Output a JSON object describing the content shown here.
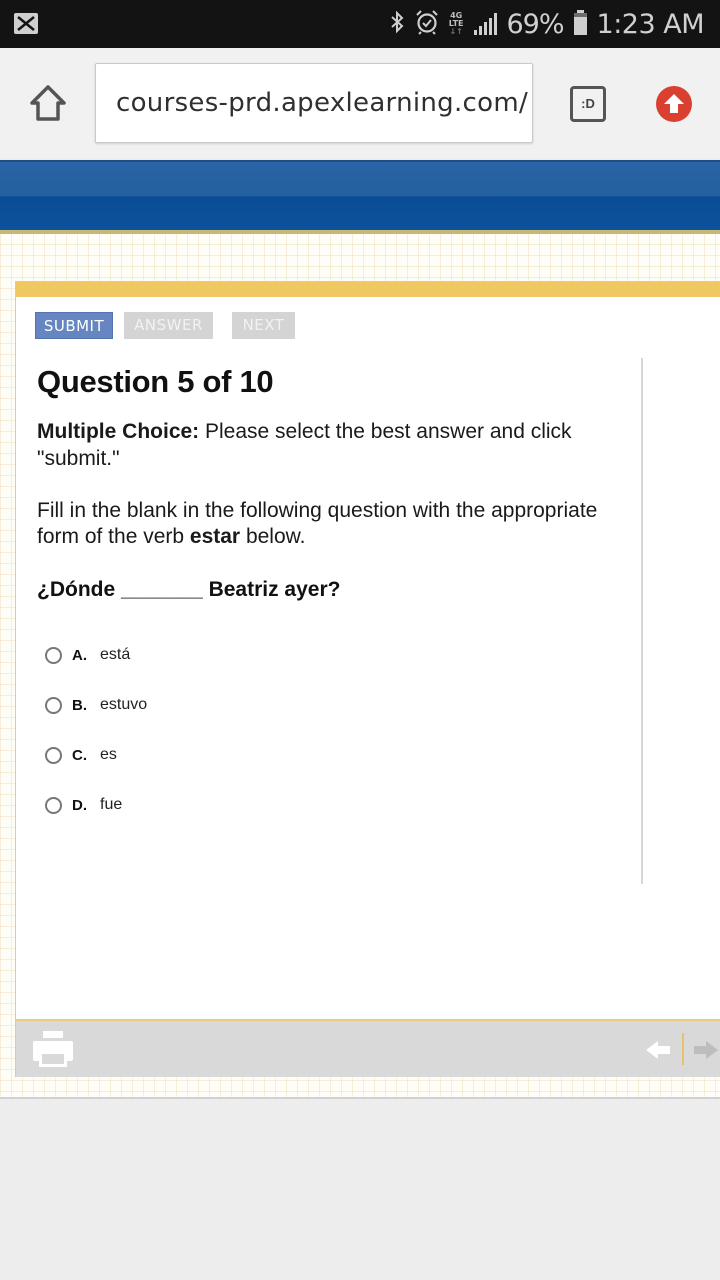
{
  "status_bar": {
    "notification_icon": "mail-x-icon",
    "icons": [
      "bluetooth-icon",
      "alarm-icon",
      "4g-lte-icon",
      "signal-icon"
    ],
    "network_label_top": "4G",
    "network_label_bottom": "LTE",
    "battery_percent": "69%",
    "time": "1:23 AM"
  },
  "browser": {
    "url": "courses-prd.apexlearning.com/",
    "tab_button_label": ":D",
    "icons": [
      "home-icon",
      "tabs-icon",
      "upload-arrow-icon"
    ]
  },
  "toolbar": {
    "submit_label": "SUBMIT",
    "answer_label": "ANSWER",
    "next_label": "NEXT"
  },
  "question": {
    "title": "Question 5 of 10",
    "instruction_bold": "Multiple Choice:",
    "instruction_text": " Please select the best answer and click \"submit.\"",
    "prompt_before": "Fill in the blank in the following question with the appropriate form of the verb ",
    "prompt_bold": "estar",
    "prompt_after": " below.",
    "sentence": "¿Dónde _______ Beatriz ayer?",
    "options": [
      {
        "letter": "A.",
        "text": "está"
      },
      {
        "letter": "B.",
        "text": "estuvo"
      },
      {
        "letter": "C.",
        "text": "es"
      },
      {
        "letter": "D.",
        "text": "fue"
      }
    ]
  },
  "footer": {
    "icons": [
      "print-icon",
      "arrow-left-icon",
      "arrow-right-icon"
    ]
  },
  "colors": {
    "header_blue": "#0c529e",
    "card_accent": "#f0c861",
    "submit_blue": "#6586c0",
    "disabled_gray": "#d4d4d4",
    "upload_red": "#d9402f"
  }
}
